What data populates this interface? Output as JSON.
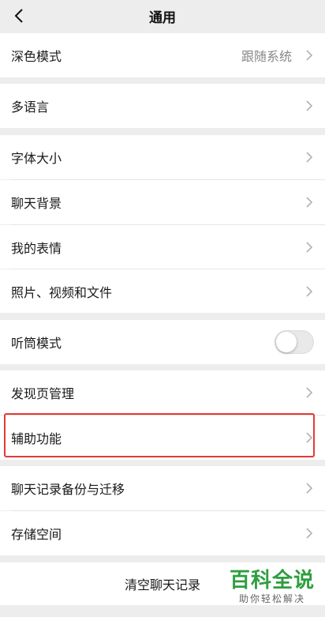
{
  "header": {
    "title": "通用",
    "back_icon": "back-chevron-icon"
  },
  "sections": {
    "dark_mode": {
      "label": "深色模式",
      "value": "跟随系统"
    },
    "language": {
      "label": "多语言"
    },
    "font_size": {
      "label": "字体大小"
    },
    "chat_background": {
      "label": "聊天背景"
    },
    "my_stickers": {
      "label": "我的表情"
    },
    "media_files": {
      "label": "照片、视频和文件"
    },
    "earpiece_mode": {
      "label": "听筒模式",
      "enabled": false
    },
    "discover_mgmt": {
      "label": "发现页管理"
    },
    "accessibility": {
      "label": "辅助功能"
    },
    "chat_backup": {
      "label": "聊天记录备份与迁移"
    },
    "storage": {
      "label": "存储空间"
    },
    "clear_history": {
      "label": "清空聊天记录"
    }
  },
  "watermark": {
    "title": "百科全说",
    "subtitle": "助你轻松解决"
  },
  "colors": {
    "background": "#ededed",
    "highlight": "#e53935",
    "watermark_green": "#2e9e3f"
  }
}
